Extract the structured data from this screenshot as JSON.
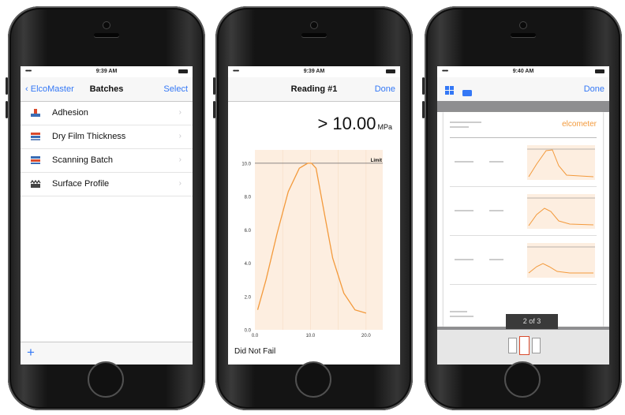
{
  "phone1": {
    "status_time": "9:39 AM",
    "signal": "•••••",
    "nav_back": "ElcoMaster",
    "nav_title": "Batches",
    "nav_right": "Select",
    "items": [
      {
        "label": "Adhesion",
        "icon": "adhesion-icon"
      },
      {
        "label": "Dry Film Thickness",
        "icon": "dft-icon"
      },
      {
        "label": "Scanning Batch",
        "icon": "scan-batch-icon"
      },
      {
        "label": "Surface Profile",
        "icon": "surface-profile-icon"
      }
    ],
    "chevron": "›",
    "toolbar_add": "+"
  },
  "phone2": {
    "status_time": "9:39 AM",
    "signal": "•••••",
    "nav_title": "Reading #1",
    "nav_right": "Done",
    "reading_value": "> 10.00",
    "reading_unit": "MPa",
    "status_text": "Did Not Fail",
    "chart_data": {
      "type": "line",
      "ylim": [
        0,
        10.8
      ],
      "xlim": [
        0,
        23
      ],
      "y_ticks": [
        "0.0",
        "2.0",
        "4.0",
        "6.0",
        "8.0",
        "10.0"
      ],
      "x_ticks": [
        "0.0",
        "10.0",
        "20.0"
      ],
      "limit_label": "Limit",
      "limit_value": 10.0,
      "x": [
        0.5,
        2,
        4,
        6,
        8,
        9.5,
        10.2,
        11,
        12.5,
        14,
        16,
        18,
        20
      ],
      "y": [
        1.2,
        3.0,
        5.8,
        8.3,
        9.7,
        10.0,
        10.0,
        9.7,
        7.0,
        4.3,
        2.2,
        1.2,
        1.0
      ],
      "line_color": "#f39a3c",
      "fill_color": "#fdeee0"
    }
  },
  "phone3": {
    "status_time": "9:40 AM",
    "signal": "•••••",
    "nav_right": "Done",
    "brand": "elcometer",
    "page_counter": "2 of 3"
  }
}
